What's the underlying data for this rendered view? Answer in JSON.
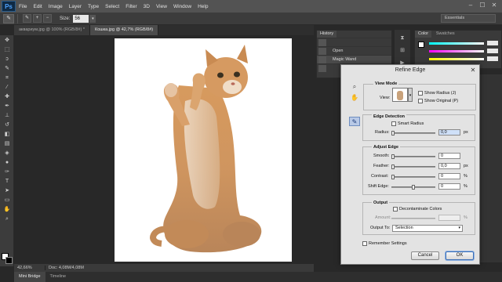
{
  "app": {
    "logo": "Ps"
  },
  "menu": [
    "File",
    "Edit",
    "Image",
    "Layer",
    "Type",
    "Select",
    "Filter",
    "3D",
    "View",
    "Window",
    "Help"
  ],
  "window_controls": [
    "–",
    "☐",
    "✕"
  ],
  "options_bar": {
    "size_label": "Size:",
    "size_value": "56",
    "workspace": "Essentials"
  },
  "doc_tabs": [
    {
      "label": "аквариум.jpg @ 100% (RGB/8#) *",
      "active": false
    },
    {
      "label": "Кошка.jpg @ 42,7% (RGB/8#)",
      "active": true
    }
  ],
  "status": {
    "zoom": "42,66%",
    "doc": "Doc: 4,08M/4,08M"
  },
  "bottom_tabs": [
    "Mini Bridge",
    "Timeline"
  ],
  "history": {
    "tab": "History",
    "items": [
      {
        "label": "",
        "selected": false
      },
      {
        "label": "Open",
        "selected": false
      },
      {
        "label": "Magic Wand",
        "selected": true
      },
      {
        "label": "",
        "selected": false
      }
    ]
  },
  "color_panel": {
    "tabs": [
      "Color",
      "Swatches"
    ]
  },
  "dialog": {
    "title": "Refine Edge",
    "view_mode": {
      "title": "View Mode",
      "view_label": "View:",
      "show_radius": "Show Radius (J)",
      "show_original": "Show Original (P)"
    },
    "edge_detection": {
      "title": "Edge Detection",
      "smart_radius": "Smart Radius",
      "radius_label": "Radius:",
      "radius_value": "0,0",
      "radius_unit": "px"
    },
    "adjust_edge": {
      "title": "Adjust Edge",
      "smooth_label": "Smooth:",
      "smooth_value": "0",
      "feather_label": "Feather:",
      "feather_value": "0,0",
      "feather_unit": "px",
      "contrast_label": "Contrast:",
      "contrast_value": "0",
      "contrast_unit": "%",
      "shift_label": "Shift Edge:",
      "shift_value": "0",
      "shift_unit": "%"
    },
    "output": {
      "title": "Output",
      "decontaminate": "Decontaminate Colors",
      "amount_label": "Amount:",
      "amount_unit": "%",
      "output_to_label": "Output To:",
      "output_to_value": "Selection"
    },
    "remember": "Remember Settings",
    "cancel": "Cancel",
    "ok": "OK"
  }
}
